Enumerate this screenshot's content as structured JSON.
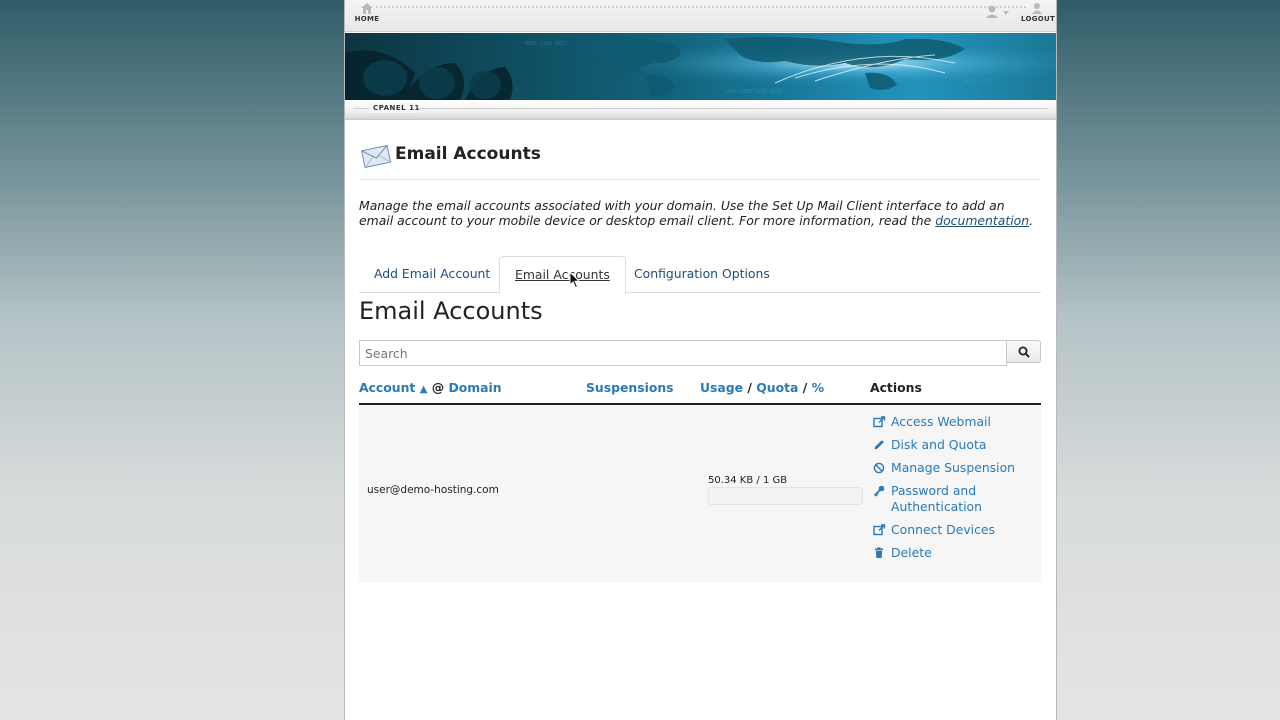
{
  "topbar": {
    "home_label": "HOME",
    "logout_label": "LOGOUT"
  },
  "subbar": {
    "brand": "CPANEL 11"
  },
  "header": {
    "title": "Email Accounts"
  },
  "description": {
    "text": "Manage the email accounts associated with your domain. Use the Set Up Mail Client interface to add an email account to your mobile device or desktop email client. For more information, read the ",
    "link": "documentation",
    "end": "."
  },
  "tabs": [
    {
      "label": "Add Email Account",
      "active": false
    },
    {
      "label": "Email Accounts",
      "active": true
    },
    {
      "label": "Configuration Options",
      "active": false
    }
  ],
  "section": {
    "title": "Email Accounts"
  },
  "search": {
    "placeholder": "Search",
    "value": ""
  },
  "table": {
    "headers": {
      "account": "Account",
      "sort_indicator": "▲",
      "at": "@",
      "domain": "Domain",
      "suspensions": "Suspensions",
      "usage": "Usage",
      "slash1": "/",
      "quota": "Quota",
      "slash2": "/",
      "percent": "%",
      "actions": "Actions"
    },
    "rows": [
      {
        "email": "user@demo-hosting.com",
        "usage": "50.34 KB / 1 GB",
        "usage_fraction": 5e-05,
        "actions": [
          {
            "label": "Access Webmail",
            "icon": "external-link-icon"
          },
          {
            "label": "Disk and Quota",
            "icon": "pencil-icon"
          },
          {
            "label": "Manage Suspension",
            "icon": "ban-icon"
          },
          {
            "label": "Password and Authentication",
            "icon": "key-icon"
          },
          {
            "label": "Connect Devices",
            "icon": "external-link-icon"
          },
          {
            "label": "Delete",
            "icon": "trash-icon"
          }
        ]
      }
    ]
  },
  "colors": {
    "link": "#2a7ab9",
    "banner": "#12627a"
  }
}
